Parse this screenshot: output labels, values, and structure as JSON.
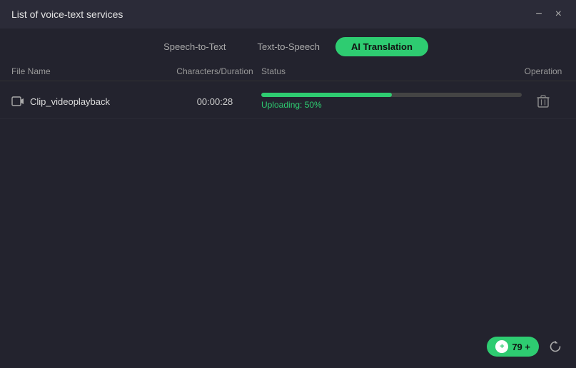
{
  "window": {
    "title": "List of voice-text services",
    "minimize_label": "−",
    "close_label": "×"
  },
  "tabs": [
    {
      "id": "speech-to-text",
      "label": "Speech-to-Text",
      "active": false
    },
    {
      "id": "text-to-speech",
      "label": "Text-to-Speech",
      "active": false
    },
    {
      "id": "ai-translation",
      "label": "AI Translation",
      "active": true
    }
  ],
  "table": {
    "columns": {
      "filename": "File Name",
      "duration": "Characters/Duration",
      "status": "Status",
      "operation": "Operation"
    },
    "rows": [
      {
        "filename": "Clip_videoplayback",
        "duration": "00:00:28",
        "progress_pct": 50,
        "status_label": "Uploading:  50%",
        "operation": "delete"
      }
    ]
  },
  "bottom": {
    "credits_count": "79",
    "credits_suffix": "+",
    "add_label": "+",
    "refresh_label": "↻"
  },
  "colors": {
    "accent": "#2ecc71",
    "progress_fill": "#2ecc71",
    "progress_track": "#444"
  }
}
